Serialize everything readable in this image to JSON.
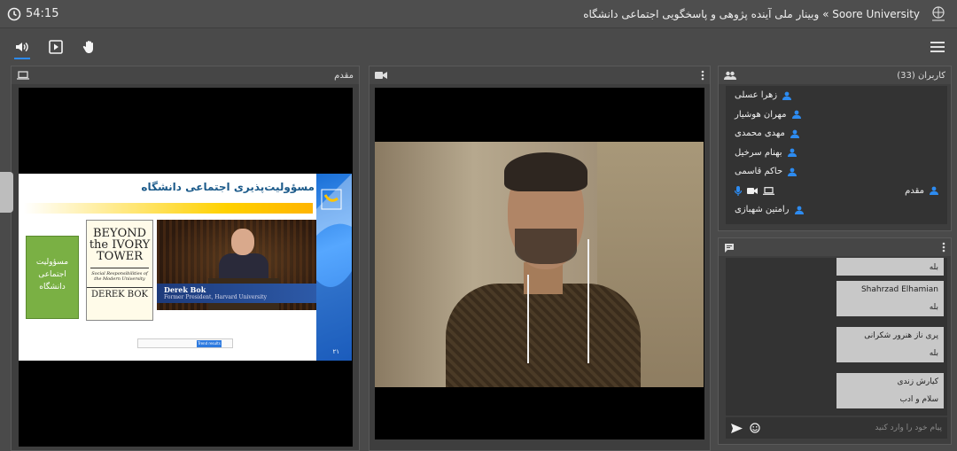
{
  "topbar": {
    "timer": "54:15",
    "title": "Soore University » وبینار ملی آینده پژوهی و پاسخگویی اجتماعی دانشگاه"
  },
  "toolbar": {
    "buttons": [
      "speaker-icon",
      "play-box-icon",
      "hand-icon"
    ],
    "active": "speaker-icon"
  },
  "presenter_panel": {
    "title": "مقدم",
    "slide": {
      "title": "مسؤولیت‌پذیری اجتماعی دانشگاه",
      "book_green": "مسؤولیت اجتماعی دانشگاه",
      "book_ivory_line1": "BEYOND",
      "book_ivory_line2": "the IVORY",
      "book_ivory_line3": "TOWER",
      "book_ivory_sub": "Social Responsibilities of the Modern University",
      "book_ivory_author": "DEREK BOK",
      "caption_name": "Derek Bok",
      "caption_role": "Former President, Harvard University",
      "search_button": "Trend results",
      "page_number": "۲۱"
    }
  },
  "video_panel": {
    "title": ""
  },
  "users_panel": {
    "title": "کاربران (33)",
    "users": [
      {
        "name": "زهرا عسلی"
      },
      {
        "name": "مهران هوشیار"
      },
      {
        "name": "مهدی محمدی"
      },
      {
        "name": "بهنام سرخیل"
      },
      {
        "name": "حاکم قاسمی"
      },
      {
        "name": "مقدم"
      },
      {
        "name": "رامتین شهبازی"
      }
    ]
  },
  "chat_panel": {
    "messages": [
      {
        "name": "",
        "text": "بله"
      },
      {
        "name": "Shahrzad Elhamian",
        "text": "بله"
      },
      {
        "name": "پری ناز هنرور شکرانی",
        "text": "بله"
      },
      {
        "name": "کیارش زندی",
        "text": "سلام و ادب"
      }
    ],
    "input_placeholder": "پیام خود را وارد کنید"
  },
  "colors": {
    "accent": "#2d8bf0",
    "panel_bg": "#3e3e3e",
    "list_bg": "#333333",
    "message_bg": "#c8c8c8"
  }
}
